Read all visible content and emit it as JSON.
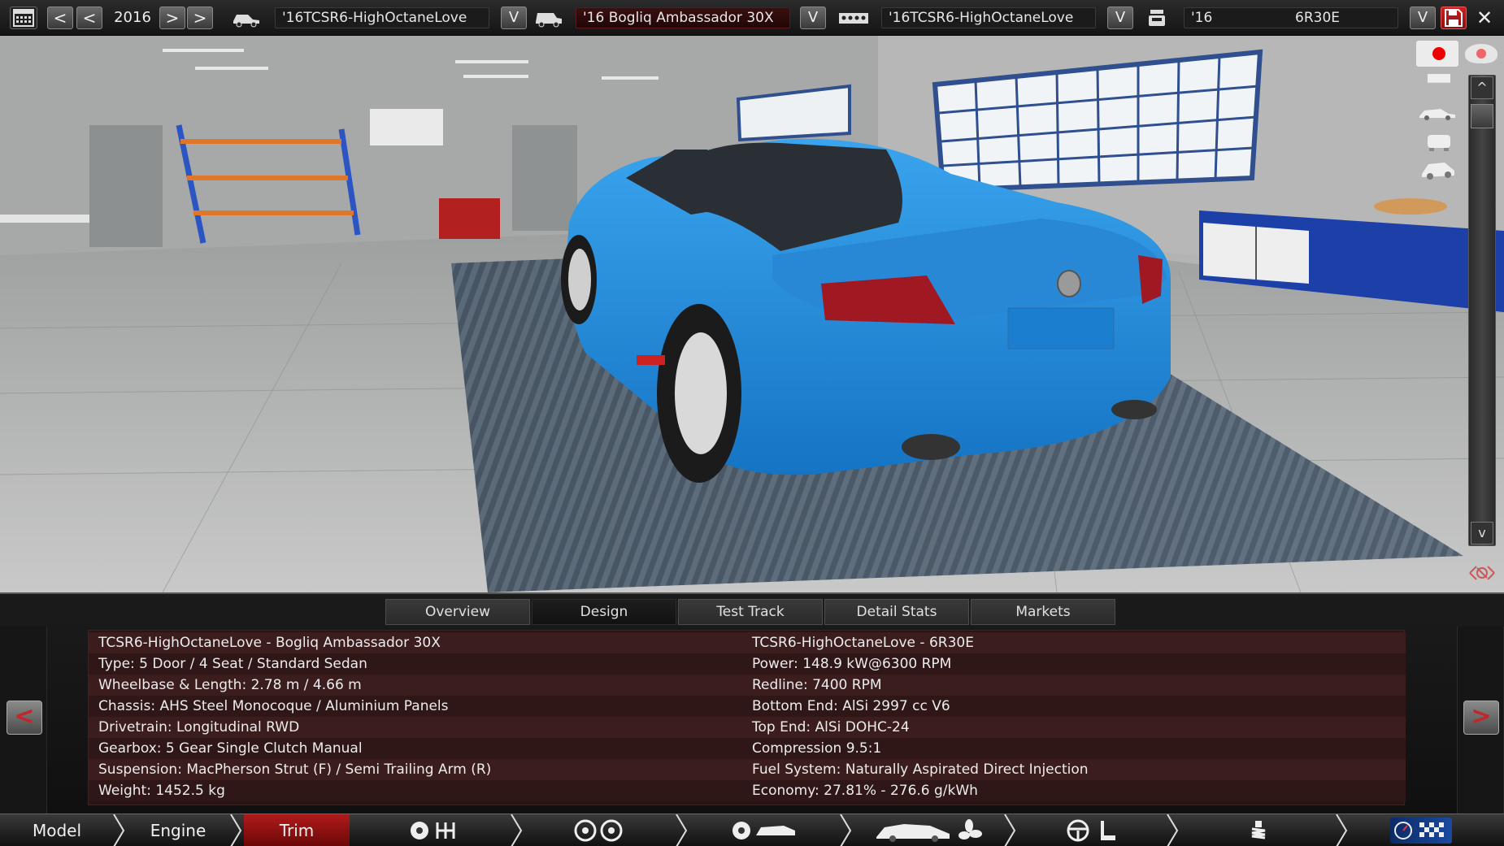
{
  "topbar": {
    "year": "2016",
    "prev_label": "<",
    "next_label": ">",
    "dropdown_label": "V",
    "car_model_field": "'16TCSR6-HighOctaneLove",
    "trim_field": "'16 Bogliq Ambassador 30X",
    "engine_family_field": "'16TCSR6-HighOctaneLove",
    "engine_variant_year": "'16",
    "engine_variant_name": "6R30E"
  },
  "viewport": {
    "up_label": "^",
    "down_label": "v"
  },
  "tabs": [
    "Overview",
    "Design",
    "Test Track",
    "Detail Stats",
    "Markets"
  ],
  "active_tab": "Design",
  "detail": {
    "left": [
      "TCSR6-HighOctaneLove - Bogliq Ambassador 30X",
      "Type: 5 Door / 4 Seat / Standard Sedan",
      "Wheelbase & Length: 2.78 m / 4.66 m",
      "Chassis: AHS Steel Monocoque / Aluminium Panels",
      "Drivetrain: Longitudinal RWD",
      "Gearbox: 5 Gear Single Clutch Manual",
      "Suspension: MacPherson Strut (F) / Semi Trailing Arm (R)",
      "Weight: 1452.5 kg"
    ],
    "right": [
      "TCSR6-HighOctaneLove - 6R30E",
      "Power: 148.9 kW@6300 RPM",
      "Redline: 7400 RPM",
      "Bottom End: AlSi 2997 cc V6",
      "Top End: AlSi DOHC-24",
      "Compression 9.5:1",
      "Fuel System: Naturally Aspirated Direct Injection",
      "Economy: 27.81% - 276.6 g/kWh"
    ],
    "prev_label": "<",
    "next_label": ">"
  },
  "nav": {
    "model": "Model",
    "engine": "Engine",
    "trim": "Trim"
  },
  "colors": {
    "car_body": "#1e8ee0",
    "accent_red": "#b01a1a",
    "panel_row_dark": "#2f1717",
    "panel_row_light": "#3c1d1d"
  }
}
